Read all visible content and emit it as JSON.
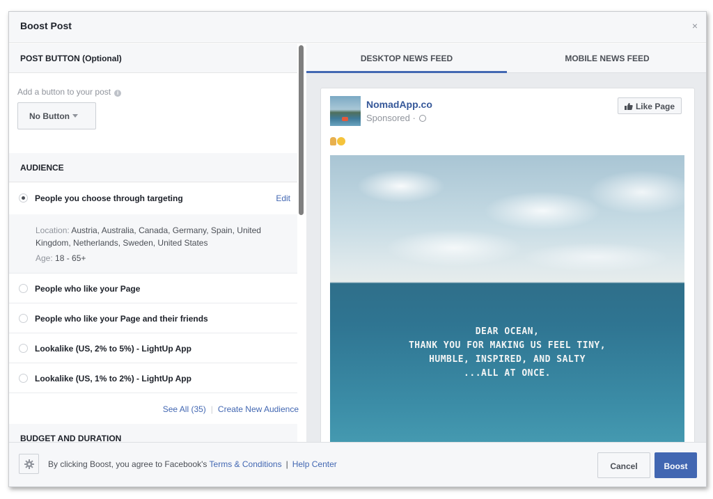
{
  "dialog": {
    "title": "Boost Post",
    "close_glyph": "×"
  },
  "post_button_section": {
    "header": "POST BUTTON (Optional)",
    "hint": "Add a button to your post",
    "info_glyph": "i",
    "button_value": "No Button"
  },
  "audience": {
    "header": "AUDIENCE",
    "selected": {
      "label": "People you choose through targeting",
      "edit_label": "Edit",
      "location_key": "Location:",
      "location_value": "Austria, Australia, Canada, Germany, Spain, United Kingdom, Netherlands, Sweden, United States",
      "age_key": "Age:",
      "age_value": "18 - 65+"
    },
    "options": [
      {
        "label": "People who like your Page"
      },
      {
        "label": "People who like your Page and their friends"
      },
      {
        "label": "Lookalike (US, 2% to 5%) - LightUp App"
      },
      {
        "label": "Lookalike (US, 1% to 2%) - LightUp App"
      }
    ],
    "see_all": "See All (35)",
    "separator": "|",
    "create_new": "Create New Audience"
  },
  "budget_section": {
    "header": "BUDGET AND DURATION"
  },
  "preview": {
    "tabs": [
      {
        "label": "DESKTOP NEWS FEED",
        "active": true
      },
      {
        "label": "MOBILE NEWS FEED",
        "active": false
      }
    ],
    "post": {
      "page_name": "NomadApp.co",
      "sponsored": "Sponsored ·",
      "like_page_label": "Like Page",
      "quote_lines": [
        "DEAR OCEAN,",
        "THANK YOU FOR MAKING US FEEL TINY,",
        "HUMBLE, INSPIRED, AND SALTY",
        "...ALL AT ONCE."
      ]
    }
  },
  "footer": {
    "terms_prefix": "By clicking Boost, you agree to Facebook's",
    "terms_link": "Terms & Conditions",
    "separator": "|",
    "help_link": "Help Center",
    "cancel_label": "Cancel",
    "boost_label": "Boost"
  },
  "colors": {
    "accent": "#4267b2",
    "link": "#4267b2",
    "page_name": "#365899",
    "panel_bg": "#f6f7f9"
  },
  "icons": [
    "close-icon",
    "info-icon",
    "dropdown-caret-icon",
    "radio-icon",
    "thumbs-up-icon",
    "globe-icon",
    "gear-icon",
    "emoji-icon"
  ]
}
